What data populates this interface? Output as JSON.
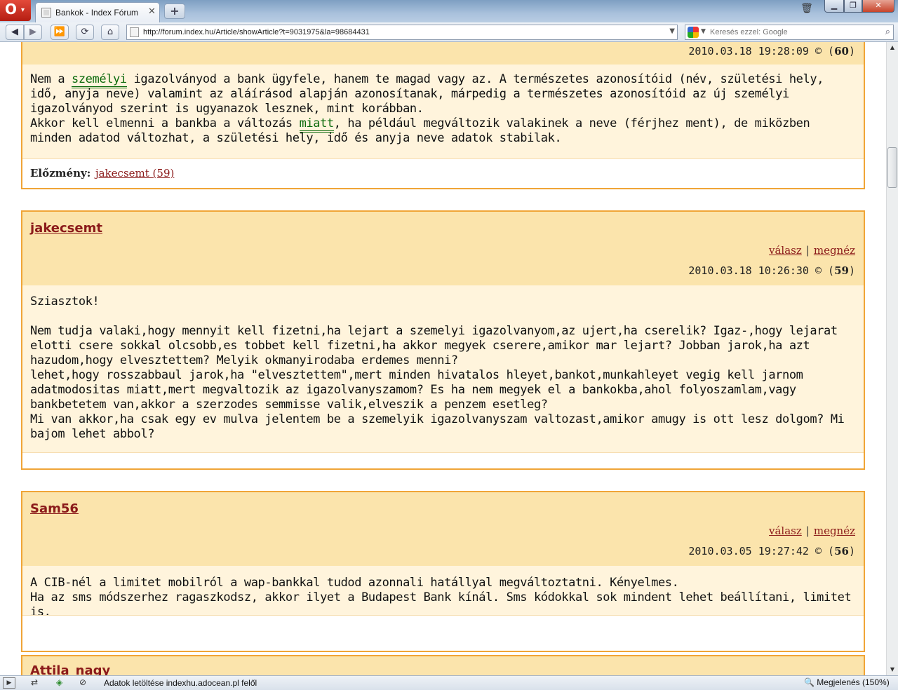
{
  "browser": {
    "tab_title": "Bankok - Index Fórum",
    "tab_close": "✕",
    "new_tab": "+",
    "opera_logo": "O",
    "url": "http://forum.index.hu/Article/showArticle?t=9031975&la=98684431",
    "search_placeholder": "Keresés ezzel: Google",
    "search_engine_icon": "google-icon",
    "status_text": "Adatok letöltése indexhu.adocean.pl felől",
    "zoom_text": "Megjelenés (150%)"
  },
  "posts": [
    {
      "meta_date": "2010.03.18 19:28:09 © (",
      "number": "60",
      "meta_close": ")",
      "body": {
        "p1_a": "Nem a ",
        "p1_kw1": "személyi",
        "p1_b": " igazolványod a bank ügyfele, hanem te magad vagy az. A természetes azonosítóid (név, születési hely, idő, anyja neve) valamint az aláírásod alapján azonosítanak, márpedig a természetes azonosítóid az új személyi igazolványod szerint is ugyanazok lesznek, mint korábban.",
        "p2_a": "Akkor kell elmenni a bankba a változás ",
        "p2_kw": "miatt",
        "p2_b": ", ha például megváltozik valakinek a neve (férjhez ment), de miközben minden adatod változhat, a születési hely, idő és anyja neve adatok stabilak."
      },
      "prev_label": "Előzmény:",
      "prev_link": "jakecsemt (59)"
    },
    {
      "author": "jakecsemt",
      "reply": "válasz",
      "separator": "|",
      "view": "megnéz",
      "meta_date": "2010.03.18 10:26:30 © (",
      "number": "59",
      "meta_close": ")",
      "body_lines": [
        "Sziasztok!",
        "",
        "Nem tudja valaki,hogy mennyit kell fizetni,ha lejart a szemelyi igazolvanyom,az ujert,ha cserelik? Igaz-,hogy lejarat elotti csere sokkal olcsobb,es tobbet kell fizetni,ha akkor megyek cserere,amikor mar lejart? Jobban jarok,ha azt hazudom,hogy elvesztettem? Melyik okmanyirodaba erdemes menni?",
        "lehet,hogy rosszabbaul jarok,ha \"elvesztettem\",mert minden hivatalos hleyet,bankot,munkahleyet vegig kell jarnom adatmodositas miatt,mert megvaltozik az igazolvanyszamom? Es ha nem megyek el a bankokba,ahol folyoszamlam,vagy bankbetetem van,akkor a szerzodes semmisse valik,elveszik a penzem esetleg?",
        "Mi van akkor,ha csak egy ev mulva jelentem be a szemelyik igazolvanyszam valtozast,amikor amugy is ott lesz dolgom? Mi bajom lehet abbol?"
      ]
    },
    {
      "author": "Sam56",
      "reply": "válasz",
      "separator": "|",
      "view": "megnéz",
      "meta_date": "2010.03.05 19:27:42 © (",
      "number": "56",
      "meta_close": ")",
      "body_lines": [
        "A CIB-nél a limitet mobilról a wap-bankkal tudod azonnali hatállyal megváltoztatni. Kényelmes.",
        "Ha az sms módszerhez ragaszkodsz, akkor ilyet a Budapest Bank kínál. Sms kódokkal sok mindent lehet beállítani, limitet is."
      ]
    },
    {
      "author": "Attila_nagy"
    }
  ],
  "colors": {
    "post_border": "#f0a537",
    "post_header_bg": "#fbe4ac",
    "post_body_bg": "#fff4dc",
    "link": "#8b1a1a",
    "keyword": "#0c6a0c"
  }
}
